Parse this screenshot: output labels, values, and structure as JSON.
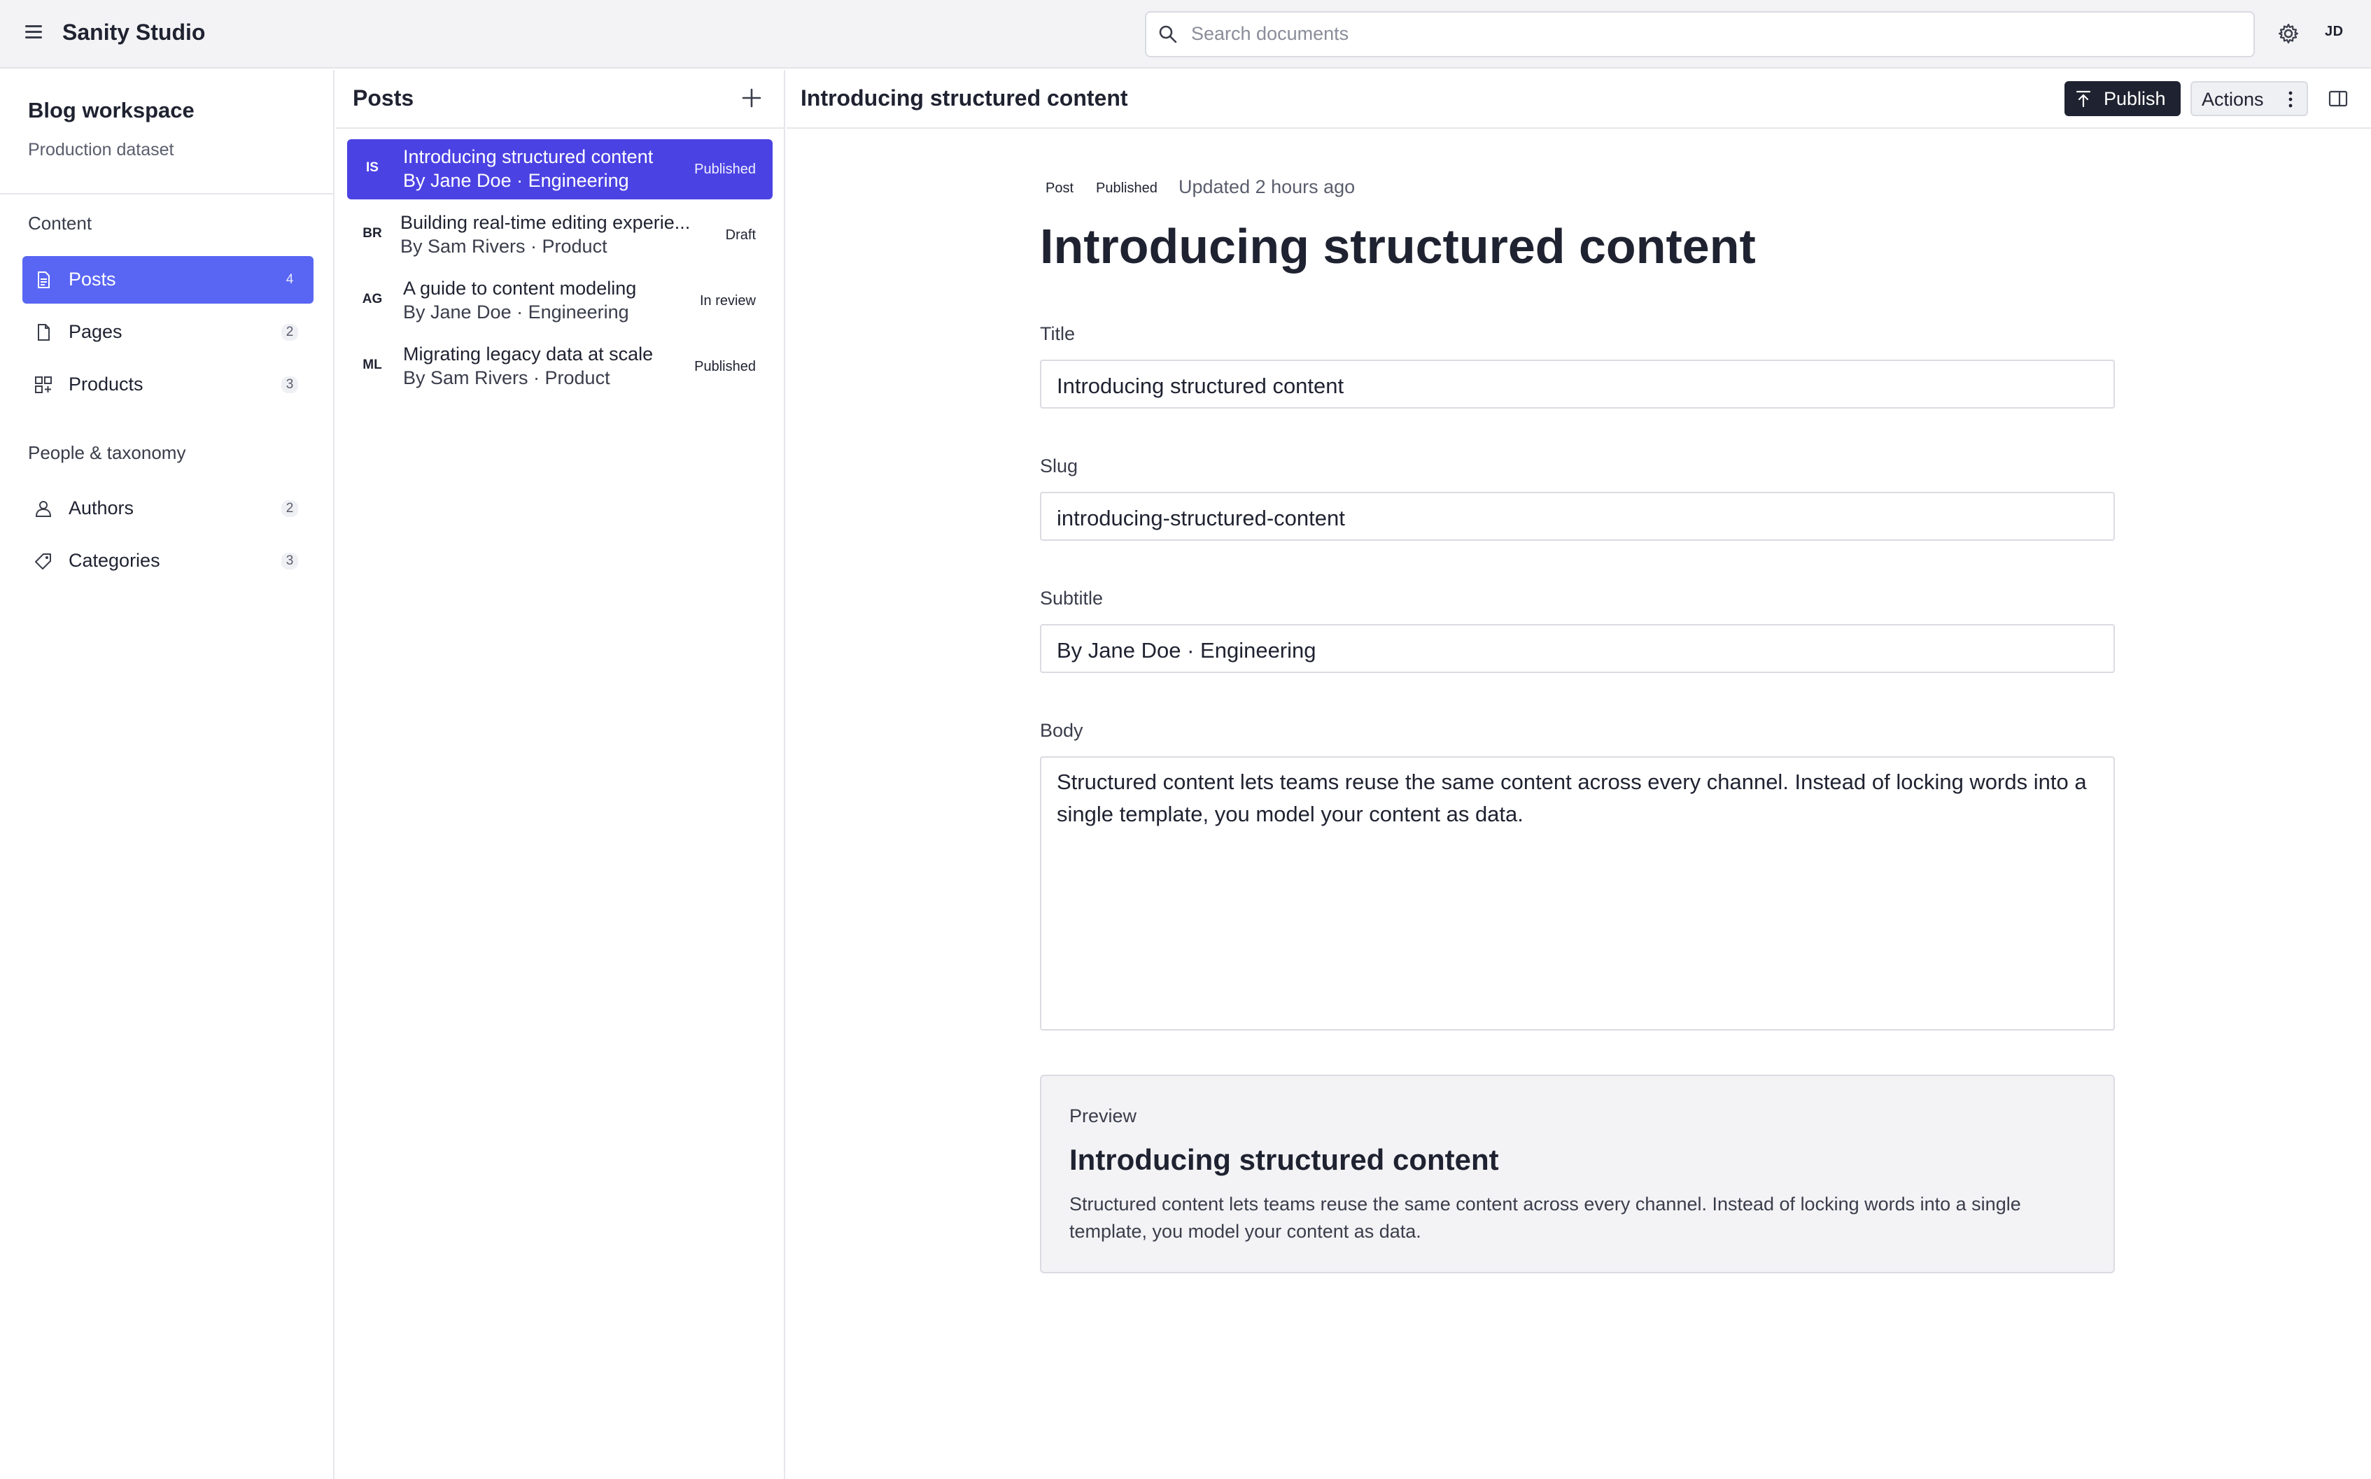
{
  "app": {
    "title": "Sanity Studio",
    "user_initials": "JD"
  },
  "search": {
    "placeholder": "Search documents"
  },
  "workspace": {
    "name": "Blog workspace",
    "dataset": "Production dataset"
  },
  "sidebar": {
    "sections": [
      {
        "title": "Content",
        "items": [
          {
            "label": "Posts",
            "count": "4",
            "icon": "document-icon",
            "active": true
          },
          {
            "label": "Pages",
            "count": "2",
            "icon": "page-icon",
            "active": false
          },
          {
            "label": "Products",
            "count": "3",
            "icon": "grid-icon",
            "active": false
          }
        ]
      },
      {
        "title": "People & taxonomy",
        "items": [
          {
            "label": "Authors",
            "count": "2",
            "icon": "users-icon",
            "active": false
          },
          {
            "label": "Categories",
            "count": "3",
            "icon": "tag-icon",
            "active": false
          }
        ]
      }
    ]
  },
  "list": {
    "title": "Posts",
    "rows": [
      {
        "initials": "IS",
        "title": "Introducing structured content",
        "subtitle": "By Jane Doe · Engineering",
        "status": "Published",
        "active": true
      },
      {
        "initials": "BR",
        "title": "Building real-time editing experie...",
        "subtitle": "By Sam Rivers · Product",
        "status": "Draft",
        "active": false
      },
      {
        "initials": "AG",
        "title": "A guide to content modeling",
        "subtitle": "By Jane Doe · Engineering",
        "status": "In review",
        "active": false
      },
      {
        "initials": "ML",
        "title": "Migrating legacy data at scale",
        "subtitle": "By Sam Rivers · Product",
        "status": "Published",
        "active": false
      }
    ]
  },
  "editor": {
    "header_title": "Introducing structured content",
    "publish_label": "Publish",
    "actions_label": "Actions",
    "meta": {
      "type": "Post",
      "state": "Published",
      "updated": "Updated 2 hours ago"
    },
    "heading": "Introducing structured content",
    "fields": {
      "title": {
        "label": "Title",
        "value": "Introducing structured content"
      },
      "slug": {
        "label": "Slug",
        "value": "introducing-structured-content"
      },
      "subtitle": {
        "label": "Subtitle",
        "value": "By Jane Doe · Engineering"
      },
      "body": {
        "label": "Body",
        "value": "Structured content lets teams reuse the same content across every channel. Instead of locking words into a single template, you model your content as data."
      }
    },
    "preview": {
      "label": "Preview",
      "title": "Introducing structured content",
      "text": "Structured content lets teams reuse the same content across every channel. Instead of locking words into a single template, you model your content as data."
    }
  },
  "colors": {
    "accent": "#5966f3",
    "selected_row": "#4b42e3",
    "dark_button": "#1f2230"
  }
}
